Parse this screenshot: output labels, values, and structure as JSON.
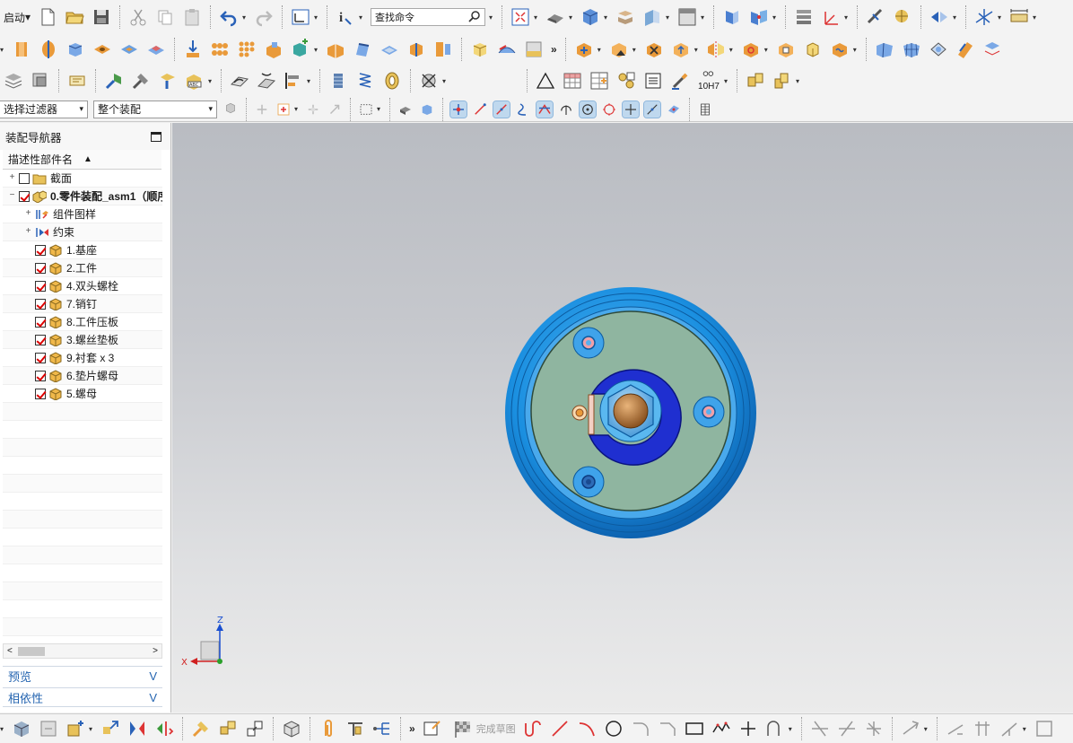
{
  "toolbar": {
    "start_label": "启动",
    "command_search_placeholder": "查找命令",
    "more_symbol": "»",
    "tolerance_label": "10H7",
    "selection_filter": "选择过滤器",
    "assembly_scope": "整个装配",
    "finish_sketch_label": "完成草图"
  },
  "navigator": {
    "title": "装配导航器",
    "column_header": "描述性部件名",
    "sort_indicator": "▲",
    "tree": [
      {
        "label": "截面",
        "level": 1,
        "toggle": "+",
        "checked": false,
        "icon": "folder-icon"
      },
      {
        "label": "0.零件装配_asm1（顺序",
        "level": 1,
        "toggle": "−",
        "checked": true,
        "icon": "assembly-icon",
        "bold": true
      },
      {
        "label": "组件图样",
        "level": 2,
        "toggle": "+",
        "checked": null,
        "icon": "component-pattern-icon"
      },
      {
        "label": "约束",
        "level": 2,
        "toggle": "+",
        "checked": null,
        "icon": "constraints-icon"
      },
      {
        "label": "1.基座",
        "level": 2,
        "toggle": "",
        "checked": true,
        "icon": "part-icon"
      },
      {
        "label": "2.工件",
        "level": 2,
        "toggle": "",
        "checked": true,
        "icon": "part-icon"
      },
      {
        "label": "4.双头螺栓",
        "level": 2,
        "toggle": "",
        "checked": true,
        "icon": "part-icon"
      },
      {
        "label": "7.销钉",
        "level": 2,
        "toggle": "",
        "checked": true,
        "icon": "part-icon"
      },
      {
        "label": "8.工件压板",
        "level": 2,
        "toggle": "",
        "checked": true,
        "icon": "part-icon"
      },
      {
        "label": "3.螺丝垫板",
        "level": 2,
        "toggle": "",
        "checked": true,
        "icon": "part-icon"
      },
      {
        "label": "9.衬套 x 3",
        "level": 2,
        "toggle": "",
        "checked": true,
        "icon": "part-icon"
      },
      {
        "label": "6.垫片螺母",
        "level": 2,
        "toggle": "",
        "checked": true,
        "icon": "part-icon"
      },
      {
        "label": "5.螺母",
        "level": 2,
        "toggle": "",
        "checked": true,
        "icon": "part-icon"
      }
    ],
    "empty_rows": 14,
    "scroll_left": "<",
    "scroll_right": ">",
    "preview_label": "预览",
    "dependency_label": "相依性",
    "expand_symbol": "V"
  },
  "triad": {
    "z_label": "Z",
    "x_label": "X"
  },
  "colors": {
    "accent_blue": "#1f7ad8",
    "panel_link": "#2464b0",
    "model_plate": "#8fb5a0",
    "model_outer": "#1a8fe0",
    "model_clamp": "#1f2fd0",
    "model_nut_core": "#b87a3c"
  }
}
